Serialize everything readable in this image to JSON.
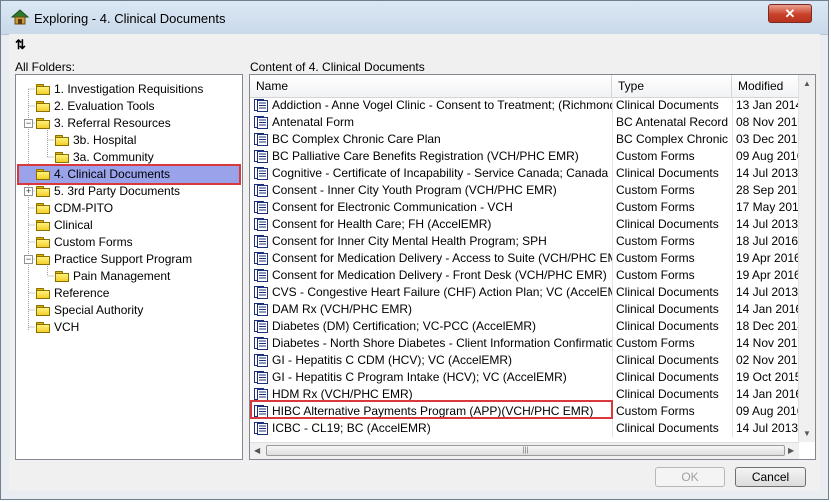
{
  "window": {
    "title": "Exploring - 4. Clinical Documents",
    "close_label": "✕"
  },
  "toolbar": {
    "refresh_glyph": "⇅"
  },
  "folders_panel": {
    "label": "All Folders:",
    "items": [
      {
        "label": "1. Investigation Requisitions"
      },
      {
        "label": "2. Evaluation Tools"
      },
      {
        "label": "3. Referral Resources"
      },
      {
        "label": "3b. Hospital"
      },
      {
        "label": "3a. Community"
      },
      {
        "label": "4. Clinical Documents"
      },
      {
        "label": "5. 3rd Party Documents"
      },
      {
        "label": "CDM-PITO"
      },
      {
        "label": "Clinical"
      },
      {
        "label": "Custom Forms"
      },
      {
        "label": "Practice Support Program"
      },
      {
        "label": "Pain Management"
      },
      {
        "label": "Reference"
      },
      {
        "label": "Special Authority"
      },
      {
        "label": "VCH"
      }
    ]
  },
  "content_panel": {
    "label": "Content of 4. Clinical Documents",
    "columns": {
      "name": "Name",
      "type": "Type",
      "modified": "Modified"
    },
    "rows": [
      {
        "name": "Addiction - Anne Vogel Clinic - Consent to Treatment; (Richmond) V...",
        "type": "Clinical Documents",
        "modified": "13 Jan 2014"
      },
      {
        "name": "Antenatal Form",
        "type": "BC Antenatal Record",
        "modified": "08 Nov 2016"
      },
      {
        "name": "BC Complex Chronic Care Plan",
        "type": "BC Complex Chronic ...",
        "modified": "03 Dec 2013"
      },
      {
        "name": "BC Palliative Care Benefits Registration (VCH/PHC EMR)",
        "type": "Custom Forms",
        "modified": "09 Aug 2016"
      },
      {
        "name": "Cognitive - Certificate of Incapability - Service Canada; Canada (Ac...",
        "type": "Clinical Documents",
        "modified": "14 Jul 2013"
      },
      {
        "name": "Consent - Inner City Youth Program (VCH/PHC EMR)",
        "type": "Custom Forms",
        "modified": "28 Sep 2016"
      },
      {
        "name": "Consent for Electronic Communication - VCH",
        "type": "Custom Forms",
        "modified": "17 May 2016"
      },
      {
        "name": "Consent for Health Care; FH (AccelEMR)",
        "type": "Clinical Documents",
        "modified": "14 Jul 2013"
      },
      {
        "name": "Consent for Inner City Mental Health Program; SPH",
        "type": "Custom Forms",
        "modified": "18 Jul 2016"
      },
      {
        "name": "Consent for Medication Delivery - Access to Suite (VCH/PHC EMR)",
        "type": "Custom Forms",
        "modified": "19 Apr 2016"
      },
      {
        "name": "Consent for Medication Delivery - Front Desk (VCH/PHC EMR)",
        "type": "Custom Forms",
        "modified": "19 Apr 2016"
      },
      {
        "name": "CVS - Congestive Heart Failure (CHF) Action Plan; VC (AccelEMR)",
        "type": "Clinical Documents",
        "modified": "14 Jul 2013"
      },
      {
        "name": "DAM Rx (VCH/PHC EMR)",
        "type": "Clinical Documents",
        "modified": "14 Jan 2016"
      },
      {
        "name": "Diabetes (DM) Certification; VC-PCC (AccelEMR)",
        "type": "Clinical Documents",
        "modified": "18 Dec 2014"
      },
      {
        "name": "Diabetes - North Shore Diabetes - Client Information Confirmation (...",
        "type": "Custom Forms",
        "modified": "14 Nov 2016"
      },
      {
        "name": "GI - Hepatitis C CDM (HCV); VC (AccelEMR)",
        "type": "Clinical Documents",
        "modified": "02 Nov 2015"
      },
      {
        "name": "GI - Hepatitis C Program Intake (HCV); VC (AccelEMR)",
        "type": "Clinical Documents",
        "modified": "19 Oct 2015"
      },
      {
        "name": "HDM Rx (VCH/PHC EMR)",
        "type": "Clinical Documents",
        "modified": "14 Jan 2016"
      },
      {
        "name": "HIBC Alternative Payments Program (APP)(VCH/PHC EMR)",
        "type": "Custom Forms",
        "modified": "09 Aug 2016"
      },
      {
        "name": "ICBC - CL19; BC (AccelEMR)",
        "type": "Clinical Documents",
        "modified": "14 Jul 2013"
      }
    ]
  },
  "buttons": {
    "ok": "OK",
    "cancel": "Cancel"
  },
  "colors": {
    "selection": "#9aa2ea",
    "highlight_border": "#d9383c",
    "close_button": "#c9412b"
  },
  "icons": {
    "window_icon": "explorer-icon",
    "folder": "folder-icon",
    "document": "form-document-icon"
  }
}
